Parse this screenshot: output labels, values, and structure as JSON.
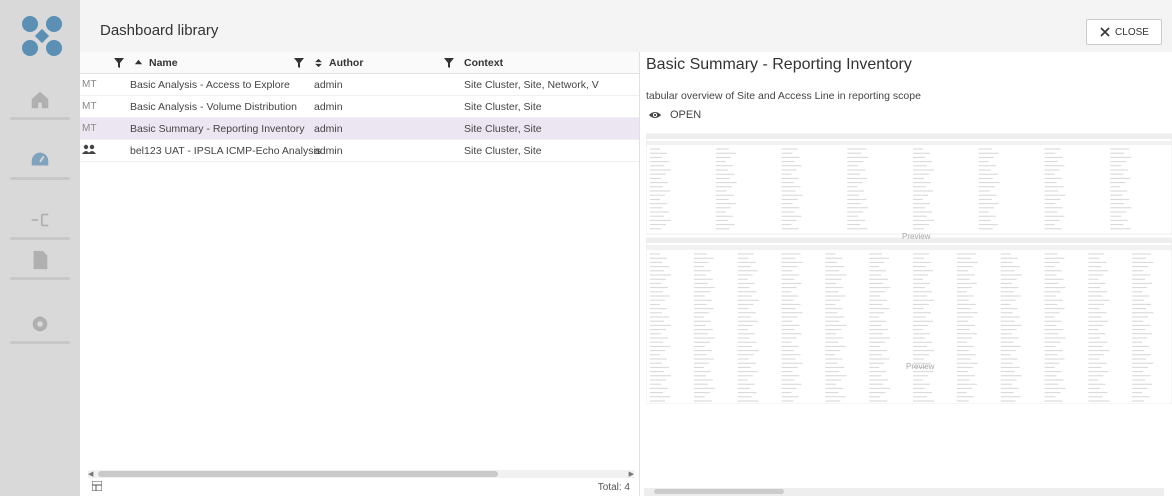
{
  "header": {
    "title": "Dashboard library",
    "close_label": "CLOSE"
  },
  "sidebar": {
    "items": [
      {
        "icon": "home-icon",
        "active": false
      },
      {
        "icon": "dashboard-icon",
        "active": true
      },
      {
        "icon": "network-icon",
        "active": false
      },
      {
        "icon": "document-icon",
        "active": false
      },
      {
        "icon": "gear-icon",
        "active": false
      }
    ]
  },
  "grid": {
    "columns": {
      "name": "Name",
      "author": "Author",
      "context": "Context"
    },
    "rows": [
      {
        "owner": "MT",
        "name": "Basic Analysis - Access to Explore",
        "author": "admin",
        "context": "Site Cluster, Site, Network, V"
      },
      {
        "owner": "MT",
        "name": "Basic Analysis - Volume Distribution",
        "author": "admin",
        "context": "Site Cluster, Site"
      },
      {
        "owner": "MT",
        "name": "Basic Summary - Reporting Inventory",
        "author": "admin",
        "context": "Site Cluster, Site"
      },
      {
        "owner": "group-icon",
        "name": "bel123 UAT - IPSLA ICMP-Echo Analysis",
        "author": "admin",
        "context": "Site Cluster, Site"
      }
    ],
    "total": "Total: 4"
  },
  "preview": {
    "title": "Basic Summary - Reporting Inventory",
    "description": "tabular overview of Site and Access Line in reporting scope",
    "open_label": "OPEN",
    "watermark": "Preview"
  }
}
